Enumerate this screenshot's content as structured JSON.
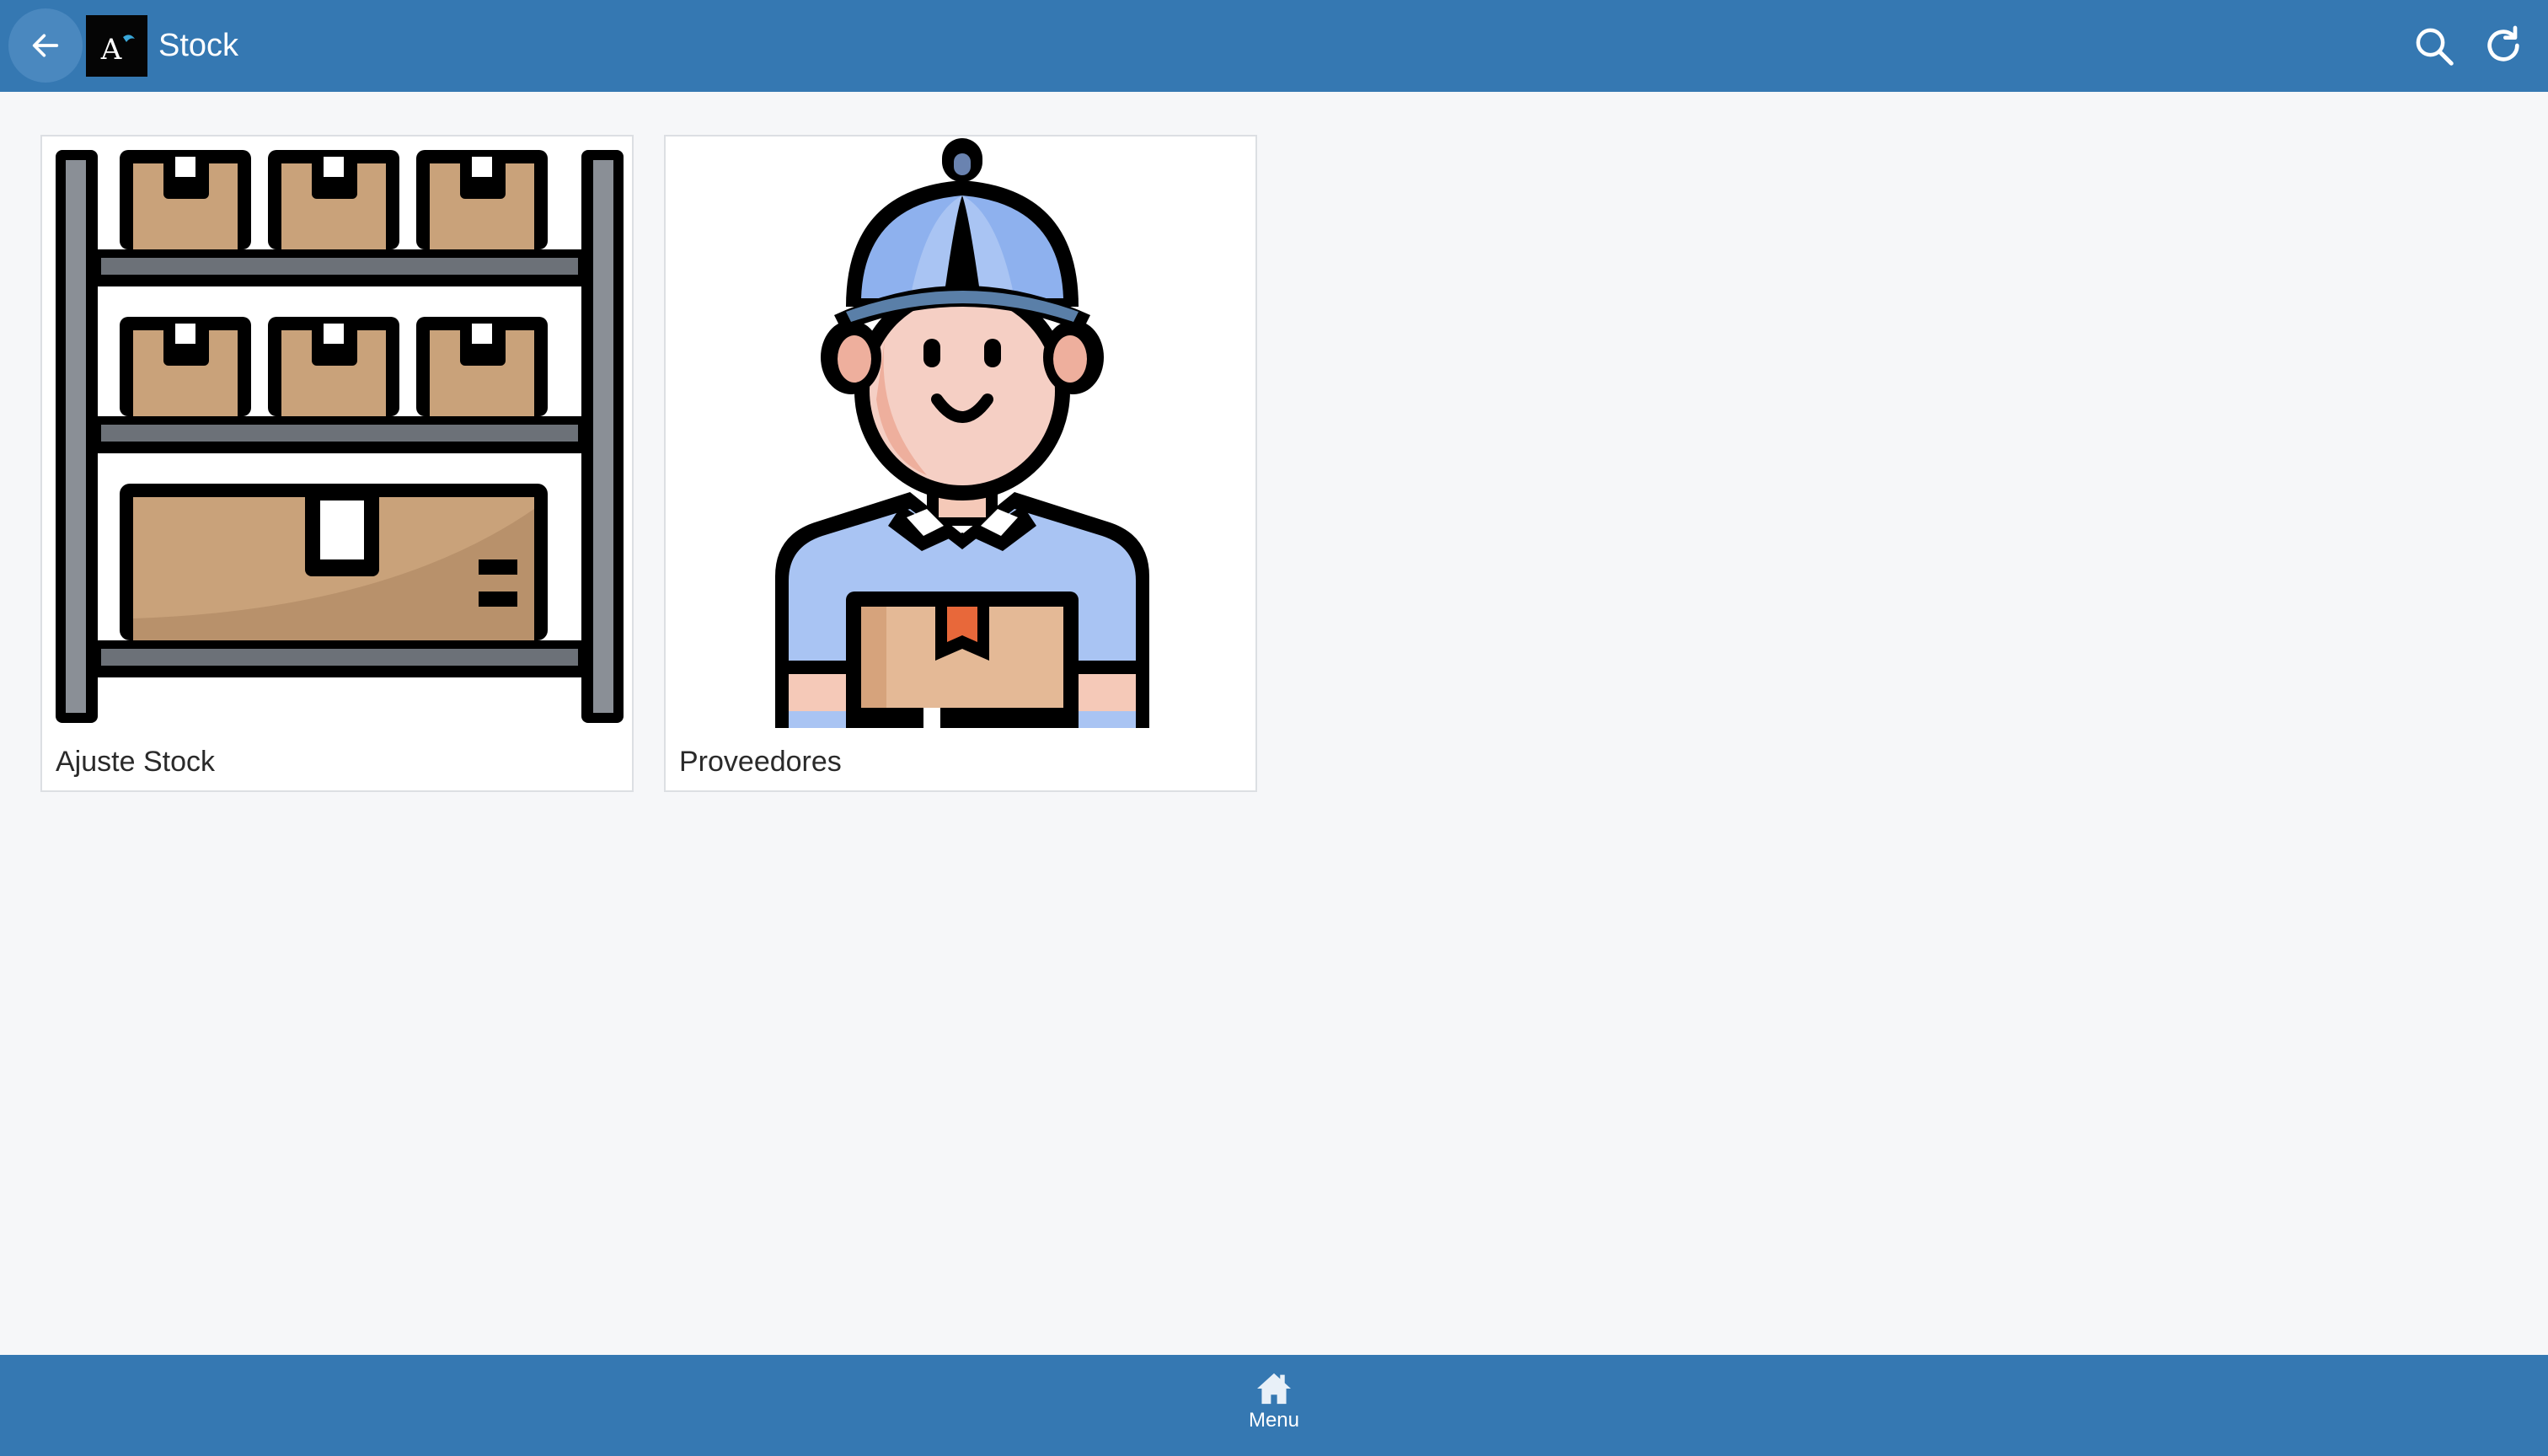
{
  "header": {
    "title": "Stock",
    "logo_letter": "A"
  },
  "cards": [
    {
      "label": "Ajuste Stock",
      "icon": "warehouse-shelf-icon"
    },
    {
      "label": "Proveedores",
      "icon": "delivery-person-icon"
    }
  ],
  "bottom_nav": {
    "menu_label": "Menu"
  },
  "colors": {
    "primary": "#3578b2",
    "background": "#f6f7f9",
    "card_border": "#dcdfe3"
  }
}
